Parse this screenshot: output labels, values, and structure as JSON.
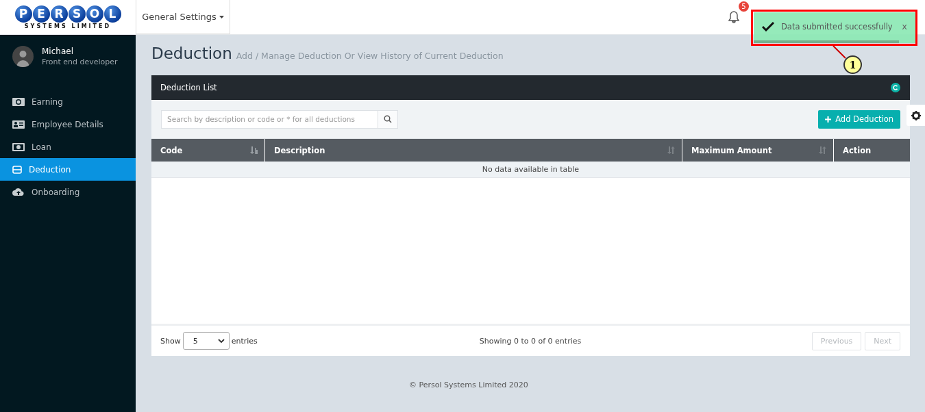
{
  "logo": {
    "letters": [
      "P",
      "E",
      "R",
      "S",
      "O",
      "L"
    ],
    "tagline": "SYSTEMS LIMITED"
  },
  "topbar": {
    "menu": "General Settings",
    "notifications": "5"
  },
  "toast": {
    "message": "Data submitted successfully",
    "close": "x",
    "level": 0.9
  },
  "callout": {
    "number": "1"
  },
  "sidebar": {
    "user": {
      "name": "Michael",
      "role": "Front end developer"
    },
    "items": [
      {
        "label": "Earning",
        "selected": false
      },
      {
        "label": "Employee Details",
        "selected": false
      },
      {
        "label": "Loan",
        "selected": false
      },
      {
        "label": "Deduction",
        "selected": true
      },
      {
        "label": "Onboarding",
        "selected": false
      }
    ]
  },
  "page": {
    "title": "Deduction",
    "subtitle": "Add / Manage Deduction Or View History of Current Deduction"
  },
  "panel": {
    "title": "Deduction List",
    "search": {
      "placeholder": "Search by description or code or * for all deductions"
    },
    "add_button": "Add Deduction"
  },
  "table": {
    "columns": [
      {
        "label": "Code",
        "sortable": true,
        "sorted": true
      },
      {
        "label": "Description",
        "sortable": true,
        "sorted": false
      },
      {
        "label": "Maximum Amount",
        "sortable": true,
        "sorted": false
      },
      {
        "label": "Action",
        "sortable": false
      }
    ],
    "empty": "No data available in table"
  },
  "footer": {
    "show": "Show",
    "page_size": "5",
    "entries": "entries",
    "info": "Showing 0 to 0 of 0 entries",
    "buttons": [
      {
        "label": "Previous",
        "disabled": true
      },
      {
        "label": "Next",
        "disabled": true
      }
    ]
  },
  "copyright": "© Persol Systems Limited 2020"
}
